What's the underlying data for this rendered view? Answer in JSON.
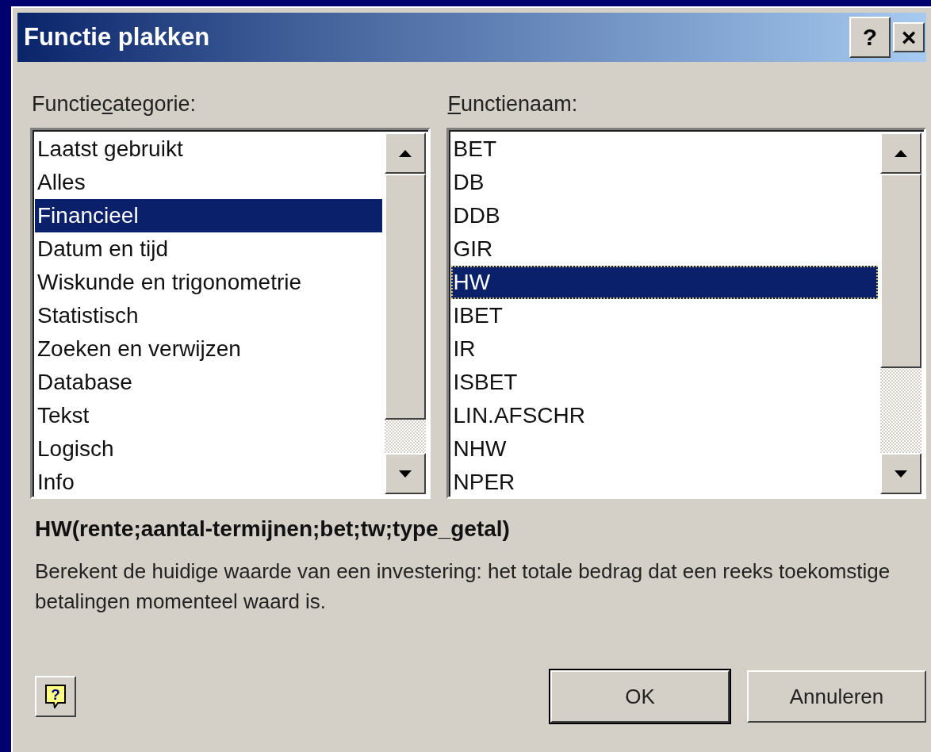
{
  "window": {
    "title": "Functie plakken",
    "title_buttons": [
      {
        "kind": "help",
        "label": "?"
      },
      {
        "kind": "close",
        "label": "×"
      }
    ]
  },
  "lists": [
    {
      "label": {
        "prefix": "Functie",
        "key": "c",
        "rest": "ategorie:"
      },
      "focused": false,
      "items": [
        {
          "label": "Laatst gebruikt",
          "selected": false
        },
        {
          "label": "Alles",
          "selected": false
        },
        {
          "label": "Financieel",
          "selected": true
        },
        {
          "label": "Datum en tijd",
          "selected": false
        },
        {
          "label": "Wiskunde en trigonometrie",
          "selected": false
        },
        {
          "label": "Statistisch",
          "selected": false
        },
        {
          "label": "Zoeken en verwijzen",
          "selected": false
        },
        {
          "label": "Database",
          "selected": false
        },
        {
          "label": "Tekst",
          "selected": false
        },
        {
          "label": "Logisch",
          "selected": false
        },
        {
          "label": "Info",
          "selected": false
        }
      ]
    },
    {
      "label": {
        "key": "F",
        "rest": "unctienaam:"
      },
      "focused": true,
      "items": [
        {
          "label": "BET",
          "selected": false
        },
        {
          "label": "DB",
          "selected": false
        },
        {
          "label": "DDB",
          "selected": false
        },
        {
          "label": "GIR",
          "selected": false
        },
        {
          "label": "HW",
          "selected": true
        },
        {
          "label": "IBET",
          "selected": false
        },
        {
          "label": "IR",
          "selected": false
        },
        {
          "label": "ISBET",
          "selected": false
        },
        {
          "label": "LIN.AFSCHR",
          "selected": false
        },
        {
          "label": "NHW",
          "selected": false
        },
        {
          "label": "NPER",
          "selected": false
        }
      ]
    }
  ],
  "syntax": "HW(rente;aantal-termijnen;bet;tw;type_getal)",
  "description": "Berekent de huidige waarde van een investering: het totale bedrag dat een reeks toekomstige betalingen momenteel waard is.",
  "help_button": {
    "glyph": "?"
  },
  "buttons": [
    {
      "label": "OK",
      "default": true
    },
    {
      "label": "Annuleren",
      "default": false
    }
  ]
}
